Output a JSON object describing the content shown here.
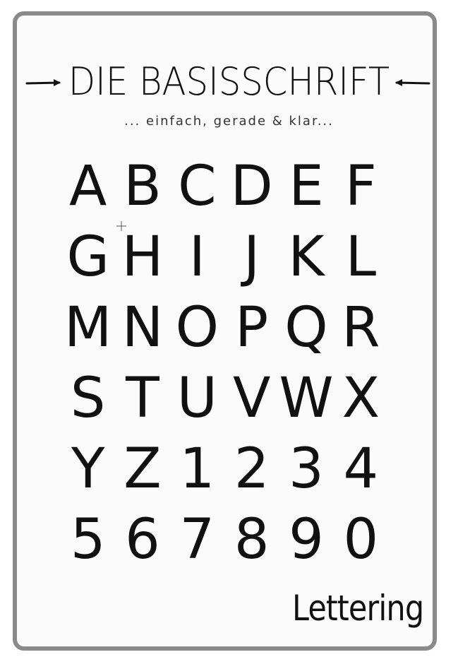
{
  "page": {
    "title": "DIE BASISSCHRIFT",
    "subtitle": "... einfach, gerade & klar...",
    "signature": "Lettering"
  },
  "glyphs": [
    "A",
    "B",
    "C",
    "D",
    "E",
    "F",
    "G",
    "H",
    "I",
    "J",
    "K",
    "L",
    "M",
    "N",
    "O",
    "P",
    "Q",
    "R",
    "S",
    "T",
    "U",
    "V",
    "W",
    "X",
    "Y",
    "Z",
    "1",
    "2",
    "3",
    "4",
    "5",
    "6",
    "7",
    "8",
    "9",
    "0"
  ],
  "colors": {
    "frame": "#8a8a8a",
    "ink": "#111111",
    "paper": "#fbfbfb"
  },
  "icons": {
    "left_arrow": "arrow-right-icon",
    "right_arrow": "arrow-left-icon",
    "cursor": "crosshair-cursor-icon"
  }
}
